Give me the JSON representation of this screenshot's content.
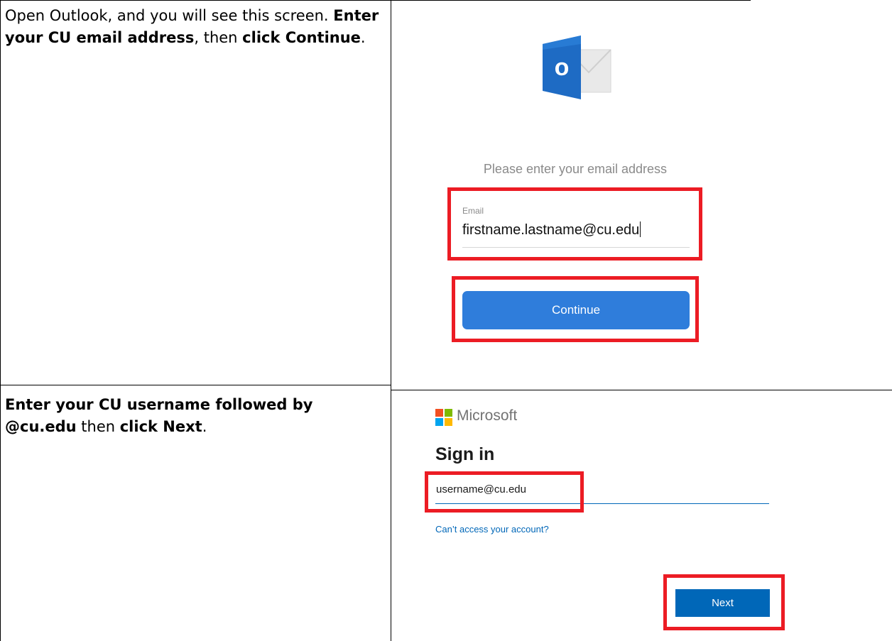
{
  "step1": {
    "instruction_parts": [
      {
        "text": "Open Outlook, and you will see this screen. ",
        "bold": false
      },
      {
        "text": "Enter your CU email address",
        "bold": true
      },
      {
        "text": ", then ",
        "bold": false
      },
      {
        "text": "click Continue",
        "bold": true
      },
      {
        "text": ".",
        "bold": false
      }
    ],
    "screenshot": {
      "logo_icon": "outlook-logo-icon",
      "logo_letter": "o",
      "prompt": "Please enter your email address",
      "email_label": "Email",
      "email_value": "firstname.lastname@cu.edu",
      "continue_label": "Continue",
      "accent_color": "#2f7ddb"
    }
  },
  "step2": {
    "instruction_parts": [
      {
        "text": "Enter your CU username followed by @cu.edu",
        "bold": true
      },
      {
        "text": " then ",
        "bold": false
      },
      {
        "text": "click Next",
        "bold": true
      },
      {
        "text": ".",
        "bold": false
      }
    ],
    "screenshot": {
      "brand": "Microsoft",
      "brand_logo_colors": [
        "#f25022",
        "#7fba00",
        "#00a4ef",
        "#ffb900"
      ],
      "title": "Sign in",
      "username_value": "username@cu.edu",
      "cant_access_link": "Can’t access your account?",
      "next_label": "Next",
      "accent_color": "#0067b8"
    }
  },
  "highlight_color": "#ec1c24"
}
